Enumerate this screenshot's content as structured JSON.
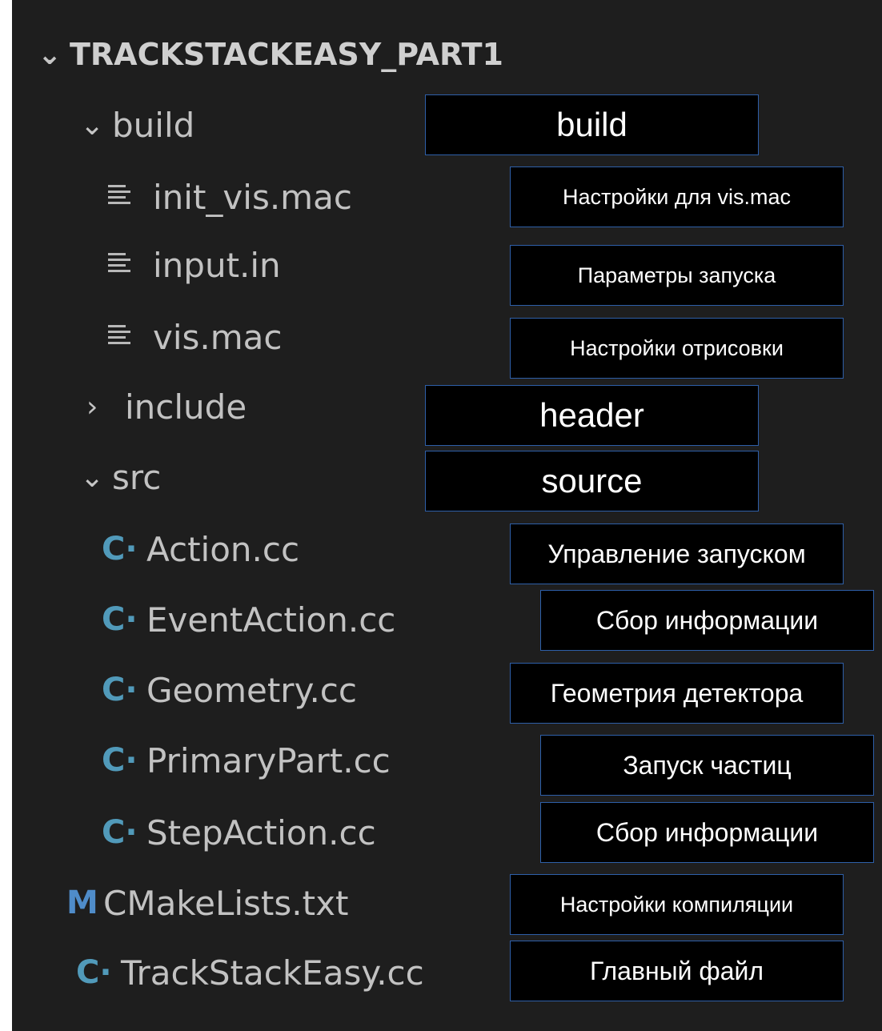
{
  "explorer": {
    "root": "TRACKSTACKEASY_PART1",
    "rows": [
      {
        "label": "build",
        "icon": "chevron-down-icon"
      },
      {
        "label": "init_vis.mac",
        "icon": "text-file-icon"
      },
      {
        "label": "input.in",
        "icon": "text-file-icon"
      },
      {
        "label": "vis.mac",
        "icon": "text-file-icon"
      },
      {
        "label": "include",
        "icon": "chevron-right-icon"
      },
      {
        "label": "src",
        "icon": "chevron-down-icon"
      },
      {
        "label": "Action.cc",
        "icon": "cpp-file-icon"
      },
      {
        "label": "EventAction.cc",
        "icon": "cpp-file-icon"
      },
      {
        "label": "Geometry.cc",
        "icon": "cpp-file-icon"
      },
      {
        "label": "PrimaryPart.cc",
        "icon": "cpp-file-icon"
      },
      {
        "label": "StepAction.cc",
        "icon": "cpp-file-icon"
      },
      {
        "label": "CMakeLists.txt",
        "icon": "cmake-file-icon"
      },
      {
        "label": "TrackStackEasy.cc",
        "icon": "cpp-file-icon"
      }
    ]
  },
  "annotations": {
    "build": "build",
    "init_vis": "Настройки для vis.mac",
    "input": "Параметры запуска",
    "vis": "Настройки отрисовки",
    "include": "header",
    "src": "source",
    "action": "Управление запуском",
    "event_action": "Сбор информации",
    "geometry": "Геометрия детектора",
    "primary_part": "Запуск частиц",
    "step_action": "Сбор информации",
    "cmake": "Настройки компиляции",
    "main": "Главный файл"
  },
  "colors": {
    "background": "#1e1e1e",
    "cpp_icon": "#519aba",
    "cmake_icon": "#4f8cc9",
    "label_border": "#2e5fa8"
  }
}
